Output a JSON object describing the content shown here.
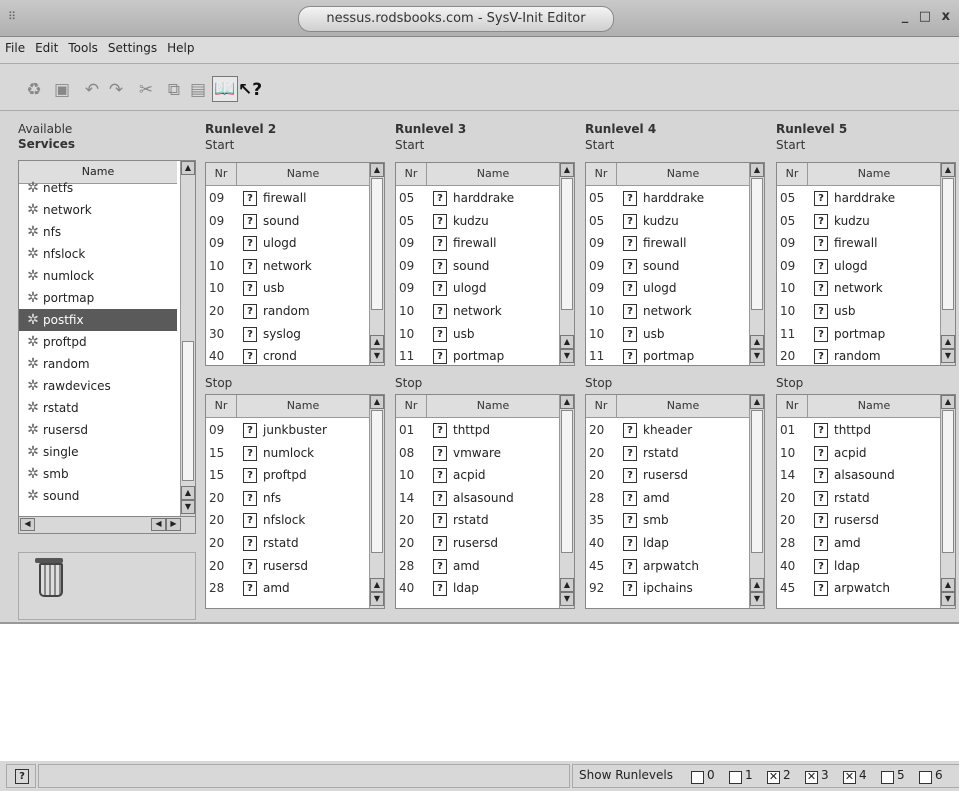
{
  "window": {
    "title": "nessus.rodsbooks.com - SysV-Init Editor",
    "controls": "_ □ x"
  },
  "menu": [
    "File",
    "Edit",
    "Tools",
    "Settings",
    "Help"
  ],
  "toolbar": [
    {
      "icon": "refresh-icon",
      "glyph": "♻"
    },
    {
      "icon": "save-icon",
      "glyph": "▣"
    },
    {
      "icon": "undo-icon",
      "glyph": "↶"
    },
    {
      "icon": "redo-icon",
      "glyph": "↷"
    },
    {
      "icon": "cut-icon",
      "glyph": "✂"
    },
    {
      "icon": "copy-icon",
      "glyph": "⧉"
    },
    {
      "icon": "paste-icon",
      "glyph": "▤"
    },
    {
      "icon": "book-icon",
      "glyph": "📖"
    },
    {
      "icon": "whats-this-help-icon",
      "glyph": "↖?"
    }
  ],
  "services": {
    "title_line1": "Available",
    "title_line2": "Services",
    "header": "Name",
    "selected": "postfix",
    "items": [
      "netfs",
      "network",
      "nfs",
      "nfslock",
      "numlock",
      "portmap",
      "postfix",
      "proftpd",
      "random",
      "rawdevices",
      "rstatd",
      "rusersd",
      "single",
      "smb",
      "sound"
    ]
  },
  "runlevels": [
    {
      "label": "Runlevel 2",
      "start": [
        [
          "09",
          "firewall"
        ],
        [
          "09",
          "sound"
        ],
        [
          "09",
          "ulogd"
        ],
        [
          "10",
          "network"
        ],
        [
          "10",
          "usb"
        ],
        [
          "20",
          "random"
        ],
        [
          "30",
          "syslog"
        ],
        [
          "40",
          "crond"
        ]
      ],
      "stop": [
        [
          "09",
          "junkbuster"
        ],
        [
          "15",
          "numlock"
        ],
        [
          "15",
          "proftpd"
        ],
        [
          "20",
          "nfs"
        ],
        [
          "20",
          "nfslock"
        ],
        [
          "20",
          "rstatd"
        ],
        [
          "20",
          "rusersd"
        ],
        [
          "28",
          "amd"
        ]
      ]
    },
    {
      "label": "Runlevel 3",
      "start": [
        [
          "05",
          "harddrake"
        ],
        [
          "05",
          "kudzu"
        ],
        [
          "09",
          "firewall"
        ],
        [
          "09",
          "sound"
        ],
        [
          "09",
          "ulogd"
        ],
        [
          "10",
          "network"
        ],
        [
          "10",
          "usb"
        ],
        [
          "11",
          "portmap"
        ]
      ],
      "stop": [
        [
          "01",
          "thttpd"
        ],
        [
          "08",
          "vmware"
        ],
        [
          "10",
          "acpid"
        ],
        [
          "14",
          "alsasound"
        ],
        [
          "20",
          "rstatd"
        ],
        [
          "20",
          "rusersd"
        ],
        [
          "28",
          "amd"
        ],
        [
          "40",
          "ldap"
        ]
      ]
    },
    {
      "label": "Runlevel 4",
      "start": [
        [
          "05",
          "harddrake"
        ],
        [
          "05",
          "kudzu"
        ],
        [
          "09",
          "firewall"
        ],
        [
          "09",
          "sound"
        ],
        [
          "09",
          "ulogd"
        ],
        [
          "10",
          "network"
        ],
        [
          "10",
          "usb"
        ],
        [
          "11",
          "portmap"
        ]
      ],
      "stop": [
        [
          "20",
          "kheader"
        ],
        [
          "20",
          "rstatd"
        ],
        [
          "20",
          "rusersd"
        ],
        [
          "28",
          "amd"
        ],
        [
          "35",
          "smb"
        ],
        [
          "40",
          "ldap"
        ],
        [
          "45",
          "arpwatch"
        ],
        [
          "92",
          "ipchains"
        ]
      ]
    },
    {
      "label": "Runlevel 5",
      "start": [
        [
          "05",
          "harddrake"
        ],
        [
          "05",
          "kudzu"
        ],
        [
          "09",
          "firewall"
        ],
        [
          "09",
          "ulogd"
        ],
        [
          "10",
          "network"
        ],
        [
          "10",
          "usb"
        ],
        [
          "11",
          "portmap"
        ],
        [
          "20",
          "random"
        ]
      ],
      "stop": [
        [
          "01",
          "thttpd"
        ],
        [
          "10",
          "acpid"
        ],
        [
          "14",
          "alsasound"
        ],
        [
          "20",
          "rstatd"
        ],
        [
          "20",
          "rusersd"
        ],
        [
          "28",
          "amd"
        ],
        [
          "40",
          "ldap"
        ],
        [
          "45",
          "arpwatch"
        ]
      ]
    }
  ],
  "labels": {
    "start": "Start",
    "stop": "Stop",
    "nr": "Nr",
    "name": "Name"
  },
  "status": {
    "show_label": "Show Runlevels",
    "runlevels": [
      {
        "n": "0",
        "checked": false
      },
      {
        "n": "1",
        "checked": false
      },
      {
        "n": "2",
        "checked": true
      },
      {
        "n": "3",
        "checked": true
      },
      {
        "n": "4",
        "checked": true
      },
      {
        "n": "5",
        "checked": false
      },
      {
        "n": "6",
        "checked": false
      }
    ]
  }
}
